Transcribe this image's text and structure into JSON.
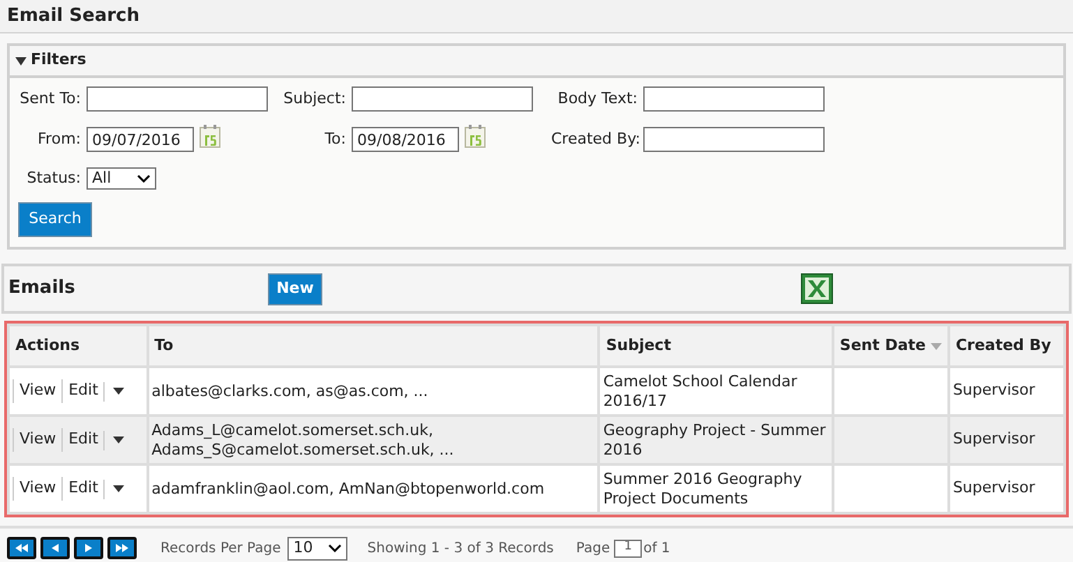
{
  "page_title": "Email Search",
  "filters": {
    "title": "Filters",
    "expanded": true,
    "rows": [
      [
        {
          "kind": "text",
          "label": "Sent To:"
        },
        {
          "kind": "text",
          "label": "Subject:"
        },
        {
          "kind": "text",
          "label": "Body Text:"
        }
      ],
      [
        {
          "kind": "date",
          "label": "From:",
          "value": "09/07/2016"
        },
        {
          "kind": "date",
          "label": "To:",
          "value": "09/08/2016"
        },
        {
          "kind": "text",
          "label": "Created By:"
        }
      ],
      [
        {
          "kind": "select",
          "label": "Status:",
          "value": "All"
        }
      ]
    ],
    "search_button": "Search"
  },
  "emails": {
    "title": "Emails",
    "new_button": "New",
    "columns": [
      {
        "label": "Actions",
        "sortable": false
      },
      {
        "label": "To",
        "sortable": false
      },
      {
        "label": "Subject",
        "sortable": false
      },
      {
        "label": "Sent Date",
        "sortable": true
      },
      {
        "label": "Created By",
        "sortable": false
      }
    ],
    "rows": [
      {
        "actions": [
          "View",
          "Edit"
        ],
        "to": "albates@clarks.com, as@as.com, ...",
        "subject": "Camelot School Calendar 2016/17",
        "created_by": "Supervisor"
      },
      {
        "actions": [
          "View",
          "Edit"
        ],
        "to": "Adams_L@camelot.somerset.sch.uk, Adams_S@camelot.somerset.sch.uk, ...",
        "subject": "Geography Project - Summer 2016",
        "created_by": "Supervisor"
      },
      {
        "actions": [
          "View",
          "Edit"
        ],
        "to": "adamfranklin@aol.com, AmNan@btopenworld.com",
        "subject": "Summer 2016 Geography Project Documents",
        "created_by": "Supervisor"
      }
    ]
  },
  "pager": {
    "per_page_label": "Records Per Page",
    "per_page": "10",
    "showing": "Showing 1 - 3 of 3 Records",
    "page_label": "Page",
    "page": "1",
    "of_label": "of 1"
  }
}
